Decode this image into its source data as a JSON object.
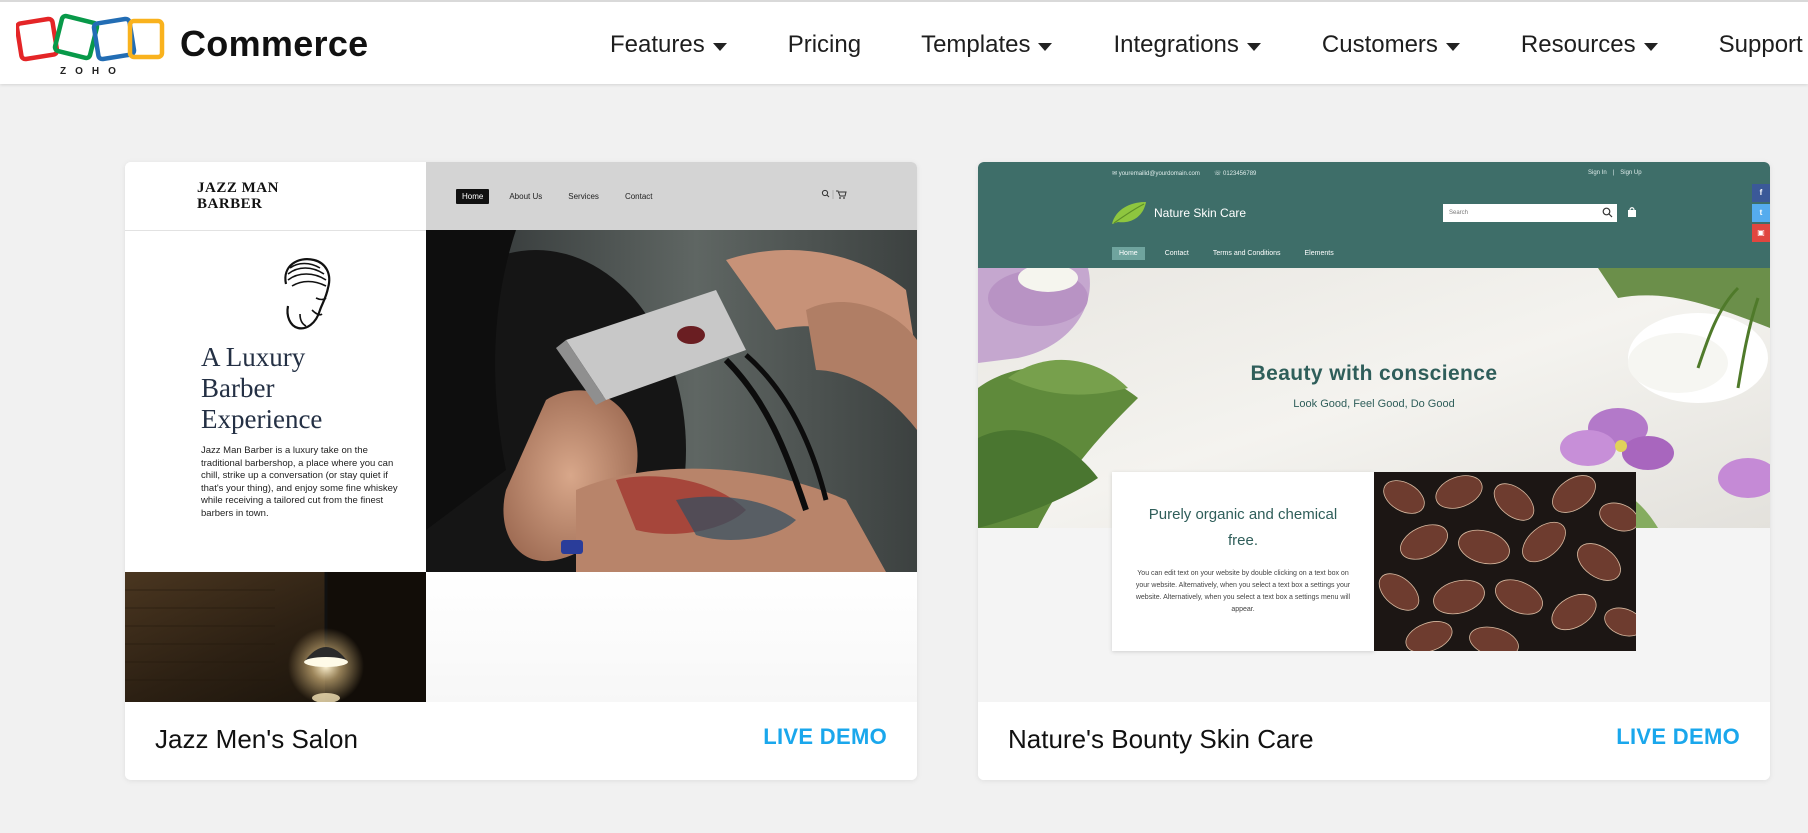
{
  "brand": {
    "logo_text": "ZOHO",
    "name": "Commerce"
  },
  "nav": {
    "items": [
      {
        "label": "Features",
        "dropdown": true
      },
      {
        "label": "Pricing",
        "dropdown": false
      },
      {
        "label": "Templates",
        "dropdown": true
      },
      {
        "label": "Integrations",
        "dropdown": true
      },
      {
        "label": "Customers",
        "dropdown": true
      },
      {
        "label": "Resources",
        "dropdown": true
      },
      {
        "label": "Support",
        "dropdown": true
      }
    ]
  },
  "cards": [
    {
      "title": "Jazz Men's Salon",
      "action_label": "LIVE DEMO",
      "preview": {
        "logo_line1": "JAZZ MAN",
        "logo_line2": "BARBER",
        "nav": [
          "Home",
          "About Us",
          "Services",
          "Contact"
        ],
        "heading_lines": [
          "A Luxury",
          "Barber",
          "Experience"
        ],
        "body": "Jazz Man Barber is a luxury take on the traditional barbershop, a place where you can chill, strike up a conversation (or stay quiet if that's your thing), and enjoy some fine whiskey while receiving a tailored cut from the finest barbers in town."
      }
    },
    {
      "title": "Nature's Bounty Skin Care",
      "action_label": "LIVE DEMO",
      "preview": {
        "email": "✉ youremailid@yourdomain.com",
        "phone": "☏ 0123456789",
        "sign_in": "Sign In",
        "sign_up": "Sign Up",
        "brand": "Nature Skin Care",
        "search_placeholder": "Search",
        "menu": [
          "Home",
          "Contact",
          "Terms and Conditions",
          "Elements"
        ],
        "social": [
          "f",
          "t",
          "▣"
        ],
        "hero_title": "Beauty with conscience",
        "hero_sub": "Look Good, Feel Good, Do Good",
        "panel_title": "Purely organic and chemical free.",
        "panel_body": "You can edit text on your website by double clicking on a text box on your website. Alternatively, when you select a text box a settings your website. Alternatively, when you select a text box a settings menu will appear."
      }
    }
  ],
  "colors": {
    "accent": "#1aa7ec",
    "nature_header": "#3e6e69",
    "nature_text": "#2f5e5a",
    "page_bg": "#f1f1f1"
  }
}
